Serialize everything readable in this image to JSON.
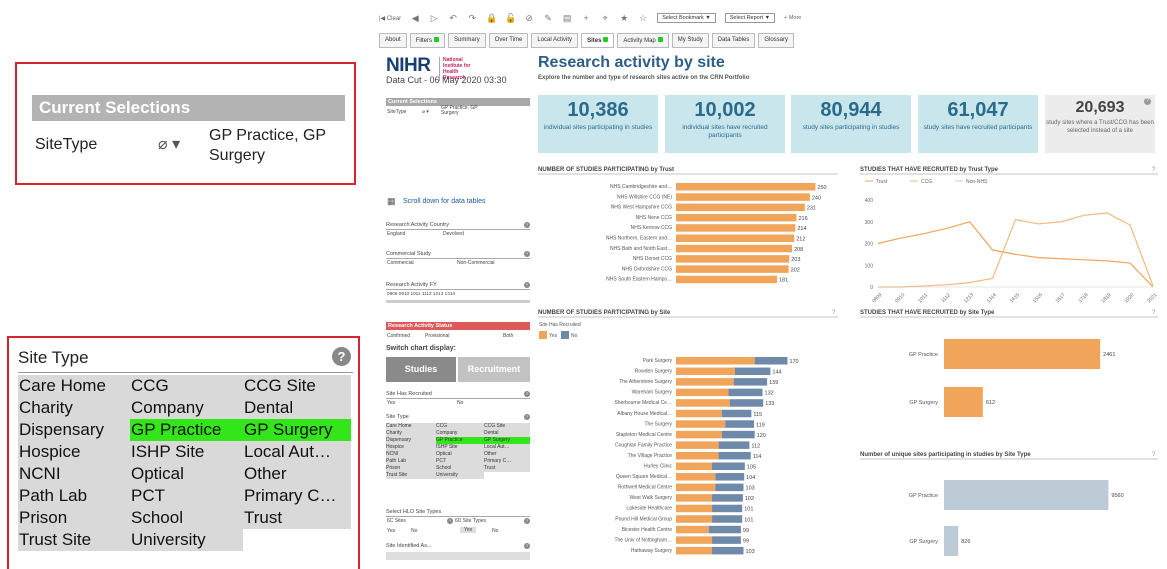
{
  "zoom_selections": {
    "header": "Current Selections",
    "field": "SiteType",
    "value": "GP Practice, GP Surgery"
  },
  "zoom_sitetype": {
    "title": "Site Type",
    "help": "?",
    "items": [
      {
        "label": "Care Home",
        "selected": false
      },
      {
        "label": "CCG",
        "selected": false
      },
      {
        "label": "CCG Site",
        "selected": false
      },
      {
        "label": "Charity",
        "selected": false
      },
      {
        "label": "Company",
        "selected": false
      },
      {
        "label": "Dental",
        "selected": false
      },
      {
        "label": "Dispensary",
        "selected": false
      },
      {
        "label": "GP Practice",
        "selected": true
      },
      {
        "label": "GP Surgery",
        "selected": true
      },
      {
        "label": "Hospice",
        "selected": false
      },
      {
        "label": "ISHP Site",
        "selected": false
      },
      {
        "label": "Local Aut…",
        "selected": false
      },
      {
        "label": "NCNI",
        "selected": false
      },
      {
        "label": "Optical",
        "selected": false
      },
      {
        "label": "Other",
        "selected": false
      },
      {
        "label": "Path Lab",
        "selected": false
      },
      {
        "label": "PCT",
        "selected": false
      },
      {
        "label": "Primary C…",
        "selected": false
      },
      {
        "label": "Prison",
        "selected": false
      },
      {
        "label": "School",
        "selected": false
      },
      {
        "label": "Trust",
        "selected": false
      },
      {
        "label": "Trust Site",
        "selected": false
      },
      {
        "label": "University",
        "selected": false
      },
      {
        "label": "",
        "selected": false
      }
    ]
  },
  "toolbar": {
    "clear": "Clear",
    "bookmark": "Select Bookmark",
    "report": "Select Report",
    "more": "More"
  },
  "tabs": [
    {
      "label": "About",
      "dot": false,
      "active": false
    },
    {
      "label": "Filters",
      "dot": true,
      "active": false
    },
    {
      "label": "Summary",
      "dot": false,
      "active": false
    },
    {
      "label": "Over Time",
      "dot": false,
      "active": false
    },
    {
      "label": "Local Activity",
      "dot": false,
      "active": false
    },
    {
      "label": "Sites",
      "dot": true,
      "active": true
    },
    {
      "label": "Activity Map",
      "dot": true,
      "active": false
    },
    {
      "label": "My Study",
      "dot": false,
      "active": false
    },
    {
      "label": "Data Tables",
      "dot": false,
      "active": false
    },
    {
      "label": "Glossary",
      "dot": false,
      "active": false
    }
  ],
  "sidebar": {
    "logo": "NIHR",
    "logo_sub": "National Institute for Health Research",
    "data_cut": "Data Cut - 06 May 2020 03:30",
    "cur_sel_header": "Current Selections",
    "cur_sel_field": "SiteType",
    "cur_sel_value": "GP Practice, GP Surgery",
    "scroll_link": "Scroll down for data tables",
    "country_title": "Research Activity Country",
    "country_a": "England",
    "country_b": "Devolved",
    "commercial_title": "Commercial Study",
    "commercial_a": "Commercial",
    "commercial_b": "Non-Commercial",
    "fy_title": "Research Activity FY",
    "fy_values": "0809  0910  1011  1112  1213  1314",
    "status_title": "Research Activity Status",
    "status_a": "Confirmed",
    "status_b": "Provisional",
    "status_c": "Both",
    "switch_label": "Switch chart display:",
    "btn_studies": "Studies",
    "btn_recruitment": "Recruitment",
    "recruited_title": "Site Has Recruited",
    "recruited_a": "Yes",
    "recruited_b": "No",
    "sitetype_title": "Site Type",
    "hlo_title": "Select HLO Site Types",
    "hlo_a": "6C Sites",
    "hlo_b": "6D Site Types",
    "hlo_yes": "Yes",
    "hlo_no": "No",
    "hlo_yes2": "Yes",
    "hlo_no2": "No",
    "identified": "Site Identified As..."
  },
  "main": {
    "title": "Research activity by site",
    "subtitle": "Explore the number and type of research sites active on the CRN Portfolio"
  },
  "cards": [
    {
      "value": "10,386",
      "desc": "individual sites participating in studies",
      "grey": false
    },
    {
      "value": "10,002",
      "desc": "individual sites have recruited participants",
      "grey": false
    },
    {
      "value": "80,944",
      "desc": "study sites participating in studies",
      "grey": false
    },
    {
      "value": "61,047",
      "desc": "study sites have recruited participants",
      "grey": false
    },
    {
      "value": "20,693",
      "desc": "study sites where a Trust/CCG has been selected instead of a site",
      "grey": true
    }
  ],
  "colors": {
    "orange": "#f0a55a",
    "blue": "#6f89ab",
    "grey_bar": "#bccbd6",
    "accent": "#2c5e8a",
    "green": "#33e619",
    "red": "#d8242f"
  },
  "chart_data": [
    {
      "type": "bar",
      "title": "NUMBER OF STUDIES PARTICIPATING by Trust",
      "categories": [
        "NHS Cambridgeshire and…",
        "NHS Willshire CCG (NE)",
        "NHS West Hampshire CCG",
        "NHS Nene CCG",
        "NHS Kernow CCG",
        "NHS Northern, Eastern and…",
        "NHS Bath and North East…",
        "NHS Dorset CCG",
        "NHS Oxfordshire CCG",
        "NHS South Eastern Hamps…"
      ],
      "values": [
        250,
        240,
        231,
        216,
        214,
        212,
        208,
        203,
        202,
        181
      ],
      "xlim": [
        0,
        260
      ]
    },
    {
      "type": "bar",
      "title": "NUMBER OF STUDIES PARTICIPATING by Site",
      "legend_title": "Site Has Recruited",
      "categories": [
        "Park Surgery",
        "Rowden Surgery",
        "The Atherstone Surgery",
        "Wareham Surgery",
        "Sherbourne Medical Ce…",
        "Albany House Medical…",
        "The Surgery",
        "Stapleton Medical Centre",
        "Coughlan Family Practice",
        "The Village Practice",
        "Hurley Clinic",
        "Queen Square Medical…",
        "Rothwell Medical Centre",
        "West Walk Surgery",
        "Lakeside Healthcare",
        "Pound Hill Medical Group",
        "Bicester Health Centre",
        "The Univ of Nottingham…",
        "Hathaway Surgery"
      ],
      "series": [
        {
          "name": "Yes",
          "values": [
            120,
            90,
            88,
            80,
            82,
            70,
            75,
            70,
            65,
            65,
            55,
            60,
            60,
            55,
            55,
            55,
            50,
            55,
            55
          ]
        },
        {
          "name": "No",
          "values": [
            50,
            54,
            51,
            52,
            51,
            45,
            44,
            50,
            47,
            49,
            50,
            44,
            43,
            47,
            46,
            46,
            49,
            44,
            48
          ]
        }
      ],
      "totals": [
        170,
        144,
        139,
        132,
        133,
        115,
        119,
        120,
        112,
        114,
        105,
        104,
        103,
        102,
        101,
        101,
        99,
        99,
        103
      ],
      "xlim": [
        0,
        180
      ]
    },
    {
      "type": "line",
      "title": "STUDIES THAT HAVE RECRUITED by Trust Type",
      "categories": [
        "0809",
        "0910",
        "1011",
        "1112",
        "1213",
        "1314",
        "1415",
        "1516",
        "1617",
        "1718",
        "1819",
        "1920",
        "2021"
      ],
      "series": [
        {
          "name": "Trust",
          "values": [
            200,
            225,
            245,
            270,
            300,
            170,
            150,
            135,
            130,
            125,
            120,
            110,
            0
          ]
        },
        {
          "name": "CCG",
          "values": [
            0,
            0,
            5,
            10,
            20,
            40,
            310,
            290,
            300,
            330,
            340,
            285,
            5
          ]
        },
        {
          "name": "Non-NHS",
          "values": [
            0,
            0,
            0,
            0,
            0,
            0,
            0,
            0,
            0,
            0,
            0,
            0,
            0
          ]
        }
      ],
      "ylim": [
        0,
        400
      ],
      "yticks": [
        0,
        100,
        200,
        300,
        400
      ]
    },
    {
      "type": "bar",
      "title": "STUDIES THAT HAVE RECRUITED by Site Type",
      "categories": [
        "GP Practice",
        "GP Surgery"
      ],
      "values": [
        2461,
        612
      ],
      "xlim": [
        0,
        2600
      ]
    },
    {
      "type": "bar",
      "title": "Number of unique sites participating in studies by Site Type",
      "categories": [
        "GP Practice",
        "GP Surgery"
      ],
      "values": [
        9560,
        826
      ],
      "xlim": [
        0,
        10000
      ]
    }
  ]
}
